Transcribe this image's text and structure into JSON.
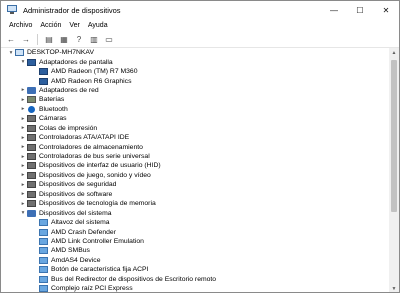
{
  "window": {
    "title": "Administrador de dispositivos",
    "minimize": "—",
    "maximize": "☐",
    "close": "✕"
  },
  "menu": [
    "Archivo",
    "Acción",
    "Ver",
    "Ayuda"
  ],
  "toolbar": [
    {
      "name": "back-icon",
      "glyph": "←"
    },
    {
      "name": "forward-icon",
      "glyph": "→"
    },
    {
      "sep": true
    },
    {
      "name": "device-list-icon",
      "glyph": "▤"
    },
    {
      "name": "properties-icon",
      "glyph": "▦"
    },
    {
      "name": "help-icon",
      "glyph": "?"
    },
    {
      "name": "view-icon",
      "glyph": "▥"
    },
    {
      "name": "monitor-icon",
      "glyph": "▭"
    }
  ],
  "tree": [
    {
      "label": "DESKTOP-MH7NKAV",
      "level": 0,
      "expander": "v",
      "icon": "computer"
    },
    {
      "label": "Adaptadores de pantalla",
      "level": 1,
      "expander": "v",
      "icon": "display"
    },
    {
      "label": "AMD Radeon (TM) R7 M360",
      "level": 2,
      "expander": "",
      "icon": "display"
    },
    {
      "label": "AMD Radeon R6 Graphics",
      "level": 2,
      "expander": "",
      "icon": "display"
    },
    {
      "label": "Adaptadores de red",
      "level": 1,
      "expander": ">",
      "icon": "folder"
    },
    {
      "label": "Baterías",
      "level": 1,
      "expander": ">",
      "icon": "battery"
    },
    {
      "label": "Bluetooth",
      "level": 1,
      "expander": ">",
      "icon": "bt"
    },
    {
      "label": "Cámaras",
      "level": 1,
      "expander": ">",
      "icon": "hw"
    },
    {
      "label": "Colas de impresión",
      "level": 1,
      "expander": ">",
      "icon": "hw"
    },
    {
      "label": "Controladoras ATA/ATAPI IDE",
      "level": 1,
      "expander": ">",
      "icon": "hw"
    },
    {
      "label": "Controladores de almacenamiento",
      "level": 1,
      "expander": ">",
      "icon": "hw"
    },
    {
      "label": "Controladoras de bus serie universal",
      "level": 1,
      "expander": ">",
      "icon": "hw"
    },
    {
      "label": "Dispositivos de interfaz de usuario (HID)",
      "level": 1,
      "expander": ">",
      "icon": "hw"
    },
    {
      "label": "Dispositivos de juego, sonido y vídeo",
      "level": 1,
      "expander": ">",
      "icon": "hw"
    },
    {
      "label": "Dispositivos de seguridad",
      "level": 1,
      "expander": ">",
      "icon": "hw"
    },
    {
      "label": "Dispositivos de software",
      "level": 1,
      "expander": ">",
      "icon": "hw"
    },
    {
      "label": "Dispositivos de tecnología de memoria",
      "level": 1,
      "expander": ">",
      "icon": "hw"
    },
    {
      "label": "Dispositivos del sistema",
      "level": 1,
      "expander": "v",
      "icon": "folder"
    },
    {
      "label": "Altavoz del sistema",
      "level": 2,
      "expander": "",
      "icon": "sys"
    },
    {
      "label": "AMD Crash Defender",
      "level": 2,
      "expander": "",
      "icon": "sys"
    },
    {
      "label": "AMD Link Controller Emulation",
      "level": 2,
      "expander": "",
      "icon": "sys"
    },
    {
      "label": "AMD SMBus",
      "level": 2,
      "expander": "",
      "icon": "sys"
    },
    {
      "label": "AmdAS4 Device",
      "level": 2,
      "expander": "",
      "icon": "sys"
    },
    {
      "label": "Botón de característica fija ACPI",
      "level": 2,
      "expander": "",
      "icon": "sys"
    },
    {
      "label": "Bus del Redirector de dispositivos de Escritorio remoto",
      "level": 2,
      "expander": "",
      "icon": "sys"
    },
    {
      "label": "Complejo raíz PCI Express",
      "level": 2,
      "expander": "",
      "icon": "sys"
    }
  ],
  "scrollbar": {
    "up": "▲",
    "down": "▼"
  }
}
